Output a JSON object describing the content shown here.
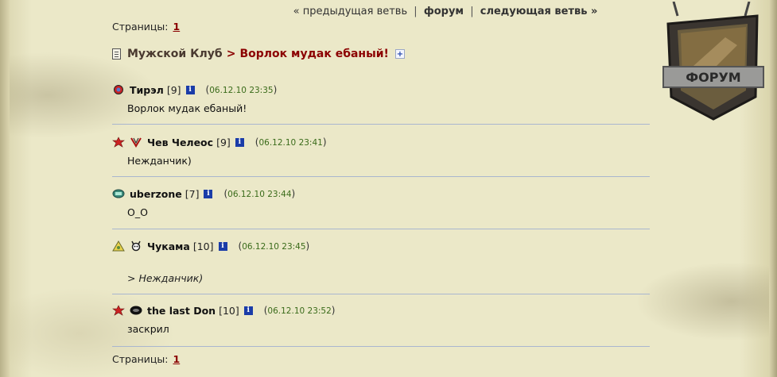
{
  "nav": {
    "prev": "« предыдущая ветвь",
    "forum": "форум",
    "next": "следующая ветвь »",
    "sep": "|"
  },
  "pages": {
    "label": "Страницы:",
    "current": "1"
  },
  "breadcrumb": {
    "forum": "Мужской Клуб",
    "gt": ">",
    "thread": "Ворлок мудак ебаный!",
    "add": "+"
  },
  "emblem": {
    "text": "ФОРУМ"
  },
  "posts": [
    {
      "nick": "Тирэл",
      "level": "[9]",
      "time": "06.12.10 23:35",
      "text": "Ворлок мудак ебаный!"
    },
    {
      "nick": "Чев Челеос",
      "level": "[9]",
      "time": "06.12.10 23:41",
      "text": "Нежданчик)"
    },
    {
      "nick": "uberzone",
      "level": "[7]",
      "time": "06.12.10 23:44",
      "text": "O_O"
    },
    {
      "nick": "Чукама",
      "level": "[10]",
      "time": "06.12.10 23:45",
      "text": "> Нежданчик)"
    },
    {
      "nick": "the last Don",
      "level": "[10]",
      "time": "06.12.10 23:52",
      "text": "заскрил"
    }
  ],
  "info_label": "i",
  "paren_open": "(",
  "paren_close": ")"
}
